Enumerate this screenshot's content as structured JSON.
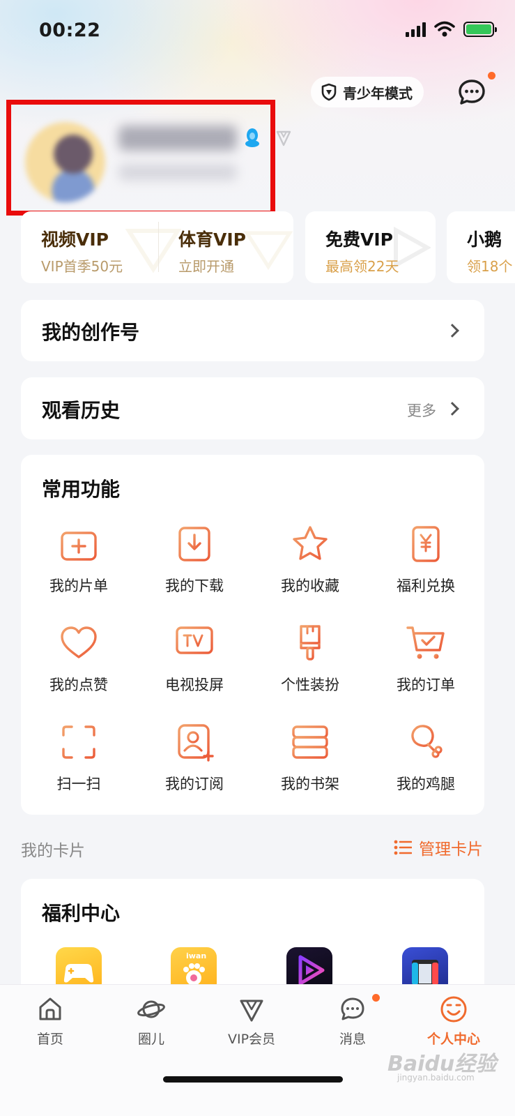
{
  "status_bar": {
    "time": "00:22"
  },
  "header": {
    "youth_mode_label": "青少年模式"
  },
  "vip_cards": [
    {
      "title": "视频VIP",
      "subtitle": "VIP首季50元"
    },
    {
      "title": "体育VIP",
      "subtitle": "立即开通"
    },
    {
      "title": "免费VIP",
      "subtitle": "最高领22天"
    },
    {
      "title": "小鹅",
      "subtitle": "领18个"
    }
  ],
  "sections": {
    "creator": {
      "title": "我的创作号"
    },
    "history": {
      "title": "观看历史",
      "more": "更多"
    },
    "functions": {
      "title": "常用功能",
      "items": [
        {
          "label": "我的片单",
          "icon": "playlist-icon"
        },
        {
          "label": "我的下载",
          "icon": "download-icon"
        },
        {
          "label": "我的收藏",
          "icon": "star-icon"
        },
        {
          "label": "福利兑换",
          "icon": "yen-coupon-icon"
        },
        {
          "label": "我的点赞",
          "icon": "heart-icon"
        },
        {
          "label": "电视投屏",
          "icon": "tv-icon"
        },
        {
          "label": "个性装扮",
          "icon": "brush-icon"
        },
        {
          "label": "我的订单",
          "icon": "cart-icon"
        },
        {
          "label": "扫一扫",
          "icon": "scan-icon"
        },
        {
          "label": "我的订阅",
          "icon": "subscribe-icon"
        },
        {
          "label": "我的书架",
          "icon": "bookshelf-icon"
        },
        {
          "label": "我的鸡腿",
          "icon": "drumstick-icon"
        }
      ]
    },
    "my_cards": {
      "label": "我的卡片",
      "manage": "管理卡片"
    },
    "welfare": {
      "title": "福利中心"
    }
  },
  "bottom_nav": [
    {
      "label": "首页",
      "icon": "home-icon",
      "active": false
    },
    {
      "label": "圈儿",
      "icon": "planet-icon",
      "active": false
    },
    {
      "label": "VIP会员",
      "icon": "vip-icon",
      "active": false
    },
    {
      "label": "消息",
      "icon": "message-icon",
      "active": false
    },
    {
      "label": "个人中心",
      "icon": "smile-icon",
      "active": true
    }
  ],
  "watermark": {
    "text": "Baidu经验",
    "sub": "jingyan.baidu.com"
  },
  "colors": {
    "accent": "#f06a2d",
    "highlight_box": "#e90c0c",
    "vip_gold": "#4a2e0a"
  }
}
